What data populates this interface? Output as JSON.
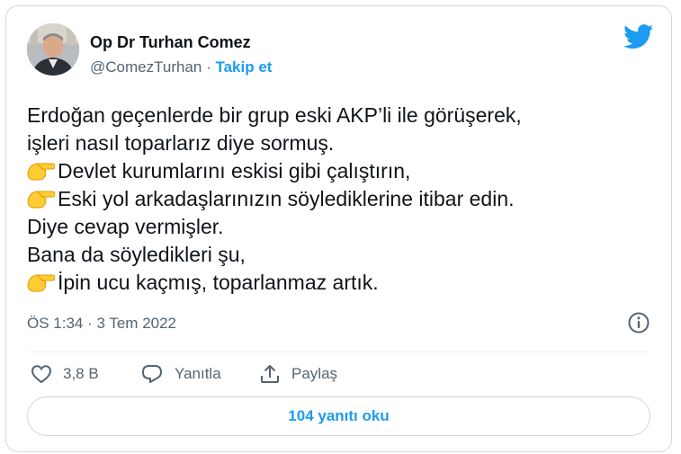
{
  "author": {
    "name": "Op Dr Turhan Comez",
    "handle": "@ComezTurhan",
    "separator": "·",
    "follow_label": "Takip et"
  },
  "tweet": {
    "lines": [
      {
        "emoji": "",
        "text": "Erdoğan geçenlerde bir grup eski AKP’li ile görüşerek,"
      },
      {
        "emoji": "",
        "text": "işleri nasıl toparlarız diye sormuş."
      },
      {
        "emoji": "pointing-hand-icon",
        "text": "Devlet kurumlarını eskisi gibi çalıştırın,"
      },
      {
        "emoji": "pointing-hand-icon",
        "text": "Eski yol arkadaşlarınızın söylediklerine itibar edin."
      },
      {
        "emoji": "",
        "text": "Diye cevap vermişler."
      },
      {
        "emoji": "",
        "text": "Bana da söyledikleri şu,"
      },
      {
        "emoji": "pointing-hand-icon",
        "text": "İpin ucu kaçmış, toparlanmaz artık."
      }
    ],
    "timestamp": "ÖS 1:34 · 3 Tem 2022"
  },
  "actions": {
    "like_count": "3,8 B",
    "reply_label": "Yanıtla",
    "share_label": "Paylaş"
  },
  "read_replies_label": "104 yanıtı oku",
  "colors": {
    "accent": "#1d9bf0",
    "text": "#0f1419",
    "secondary": "#536471",
    "border": "#cfd9de"
  }
}
